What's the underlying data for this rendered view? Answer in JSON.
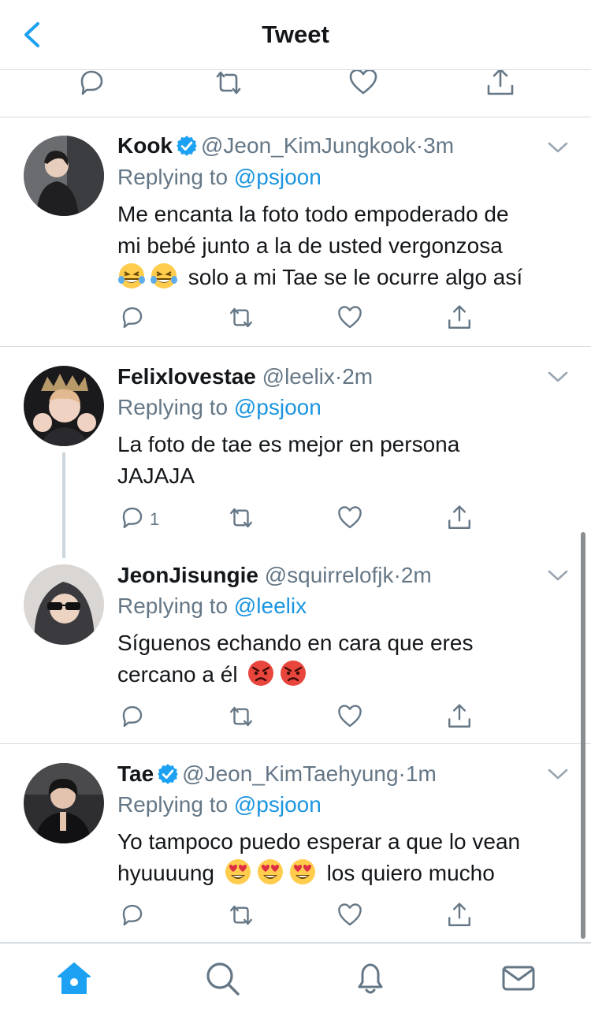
{
  "header": {
    "title": "Tweet"
  },
  "tweets": [
    {
      "name": "Kook",
      "verified": true,
      "handle": "@Jeon_KimJungkook",
      "separator": "·",
      "time": "3m",
      "reply_prefix": "Replying to",
      "reply_to": "@psjoon",
      "text_lines": [
        "Me encanta la foto todo empoderado de",
        "mi bebé junto a la de usted vergonzosa"
      ],
      "text_tail": "solo a mi Tae se le ocurre algo así",
      "emojis": [
        "laughing-tears",
        "laughing-tears"
      ]
    },
    {
      "name": "Felixlovestae",
      "verified": false,
      "handle": "@leelix",
      "separator": "·",
      "time": "2m",
      "reply_prefix": "Replying to",
      "reply_to": "@psjoon",
      "text_lines": [
        "La foto de tae es mejor en persona",
        "JAJAJA"
      ],
      "reply_count": "1"
    },
    {
      "name": "JeonJisungie",
      "verified": false,
      "handle": "@squirrelofjk",
      "separator": "·",
      "time": "2m",
      "reply_prefix": "Replying to",
      "reply_to": "@leelix",
      "text_lines": [
        "Síguenos echando en cara que eres"
      ],
      "text_head": "cercano a él",
      "emojis": [
        "angry-face",
        "angry-face"
      ]
    },
    {
      "name": "Tae",
      "verified": true,
      "handle": "@Jeon_KimTaehyung",
      "separator": "·",
      "time": "1m",
      "reply_prefix": "Replying to",
      "reply_to": "@psjoon",
      "text_lines": [
        "Yo tampoco puedo esperar a que lo vean"
      ],
      "text_head": "hyuuuung",
      "text_tail": "los quiero mucho",
      "emojis": [
        "heart-eyes",
        "heart-eyes",
        "heart-eyes"
      ]
    }
  ],
  "tabbar": {
    "items": [
      "home-icon",
      "search-icon",
      "notifications-icon",
      "messages-icon"
    ]
  },
  "colors": {
    "accent": "#1da1f2",
    "link": "#1b95e0",
    "muted": "#657786",
    "text": "#14171a",
    "divider": "#d6dbdf"
  }
}
